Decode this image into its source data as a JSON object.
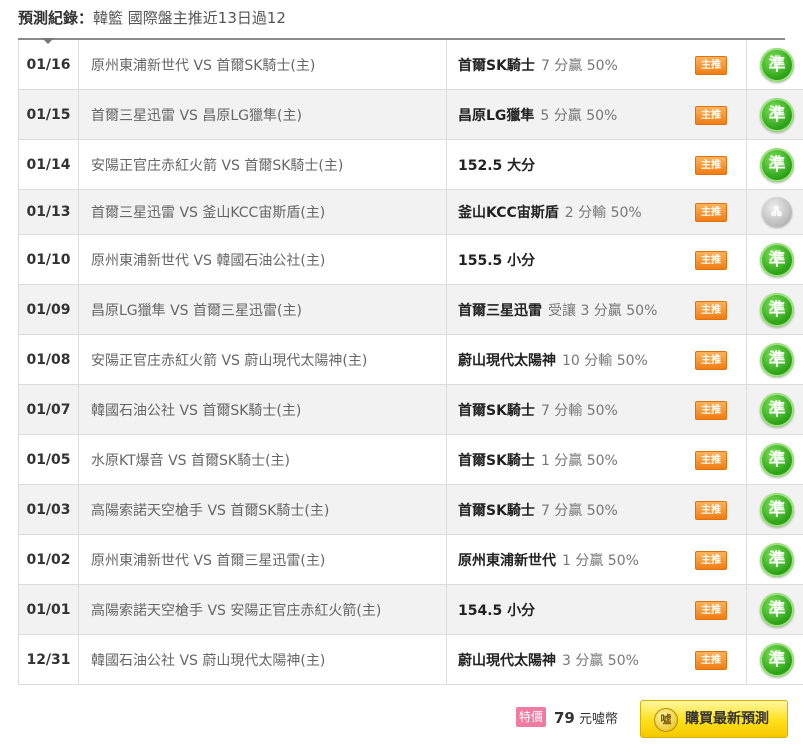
{
  "header": {
    "label": "預測紀錄：",
    "value": "韓籃 國際盤主推近13日過12"
  },
  "records": [
    {
      "date": "01/16",
      "match": "原州東浦新世代 VS 首爾SK騎士(主)",
      "pick_team": "首爾SK騎士",
      "pick_detail": "7 分贏 50%",
      "badge": "主推",
      "result": "準",
      "result_type": "win"
    },
    {
      "date": "01/15",
      "match": "首爾三星迅雷 VS 昌原LG獵隼(主)",
      "pick_team": "昌原LG獵隼",
      "pick_detail": "5 分贏 50%",
      "badge": "主推",
      "result": "準",
      "result_type": "win"
    },
    {
      "date": "01/14",
      "match": "安陽正官庄赤紅火箭 VS 首爾SK騎士(主)",
      "pick_team": "152.5 大分",
      "pick_detail": "",
      "badge": "主推",
      "result": "準",
      "result_type": "win"
    },
    {
      "date": "01/13",
      "match": "首爾三星迅雷 VS 釜山KCC宙斯盾(主)",
      "pick_team": "釜山KCC宙斯盾",
      "pick_detail": "2 分輸 50%",
      "badge": "主推",
      "result": "Ꮬ",
      "result_type": "push"
    },
    {
      "date": "01/10",
      "match": "原州東浦新世代 VS 韓國石油公社(主)",
      "pick_team": "155.5 小分",
      "pick_detail": "",
      "badge": "主推",
      "result": "準",
      "result_type": "win"
    },
    {
      "date": "01/09",
      "match": "昌原LG獵隼 VS 首爾三星迅雷(主)",
      "pick_team": "首爾三星迅雷",
      "pick_detail": "受讓 3 分贏 50%",
      "badge": "主推",
      "result": "準",
      "result_type": "win"
    },
    {
      "date": "01/08",
      "match": "安陽正官庄赤紅火箭 VS 蔚山現代太陽神(主)",
      "pick_team": "蔚山現代太陽神",
      "pick_detail": "10 分輸 50%",
      "badge": "主推",
      "result": "準",
      "result_type": "win"
    },
    {
      "date": "01/07",
      "match": "韓國石油公社 VS 首爾SK騎士(主)",
      "pick_team": "首爾SK騎士",
      "pick_detail": "7 分輸 50%",
      "badge": "主推",
      "result": "準",
      "result_type": "win"
    },
    {
      "date": "01/05",
      "match": "水原KT爆音 VS 首爾SK騎士(主)",
      "pick_team": "首爾SK騎士",
      "pick_detail": "1 分贏 50%",
      "badge": "主推",
      "result": "準",
      "result_type": "win"
    },
    {
      "date": "01/03",
      "match": "高陽索諾天空槍手 VS 首爾SK騎士(主)",
      "pick_team": "首爾SK騎士",
      "pick_detail": "7 分贏 50%",
      "badge": "主推",
      "result": "準",
      "result_type": "win"
    },
    {
      "date": "01/02",
      "match": "原州東浦新世代 VS 首爾三星迅雷(主)",
      "pick_team": "原州東浦新世代",
      "pick_detail": "1 分贏 50%",
      "badge": "主推",
      "result": "準",
      "result_type": "win"
    },
    {
      "date": "01/01",
      "match": "高陽索諾天空槍手 VS 安陽正官庄赤紅火箭(主)",
      "pick_team": "154.5 小分",
      "pick_detail": "",
      "badge": "主推",
      "result": "準",
      "result_type": "win"
    },
    {
      "date": "12/31",
      "match": "韓國石油公社 VS 蔚山現代太陽神(主)",
      "pick_team": "蔚山現代太陽神",
      "pick_detail": "3 分贏 50%",
      "badge": "主推",
      "result": "準",
      "result_type": "win"
    }
  ],
  "footer": {
    "special_label": "特價",
    "price_value": "79",
    "price_unit": "元噓幣",
    "buy_coin": "噓",
    "buy_label": "購買最新預測"
  },
  "colors": {
    "win": "#2fa51a",
    "push": "#bdbdbd",
    "badge": "#f07d14",
    "special": "#f07aa0",
    "buy": "#ffe01a"
  },
  "icons": {
    "win": "green-circle-icon",
    "push": "grey-circle-icon",
    "coin": "coin-icon"
  }
}
